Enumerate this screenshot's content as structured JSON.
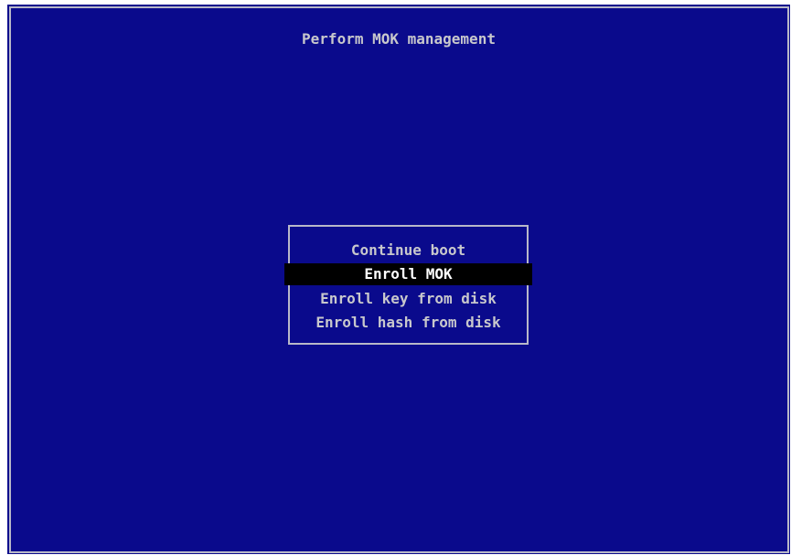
{
  "screen": {
    "title": "Perform MOK management",
    "colors": {
      "background": "#0a0a8c",
      "text": "#c8c8cc",
      "border": "#b8b8c8",
      "selected_background": "#000000",
      "selected_text": "#ffffff"
    }
  },
  "menu": {
    "selected_index": 1,
    "items": [
      {
        "label": "Continue boot"
      },
      {
        "label": "Enroll MOK"
      },
      {
        "label": "Enroll key from disk"
      },
      {
        "label": "Enroll hash from disk"
      }
    ]
  }
}
